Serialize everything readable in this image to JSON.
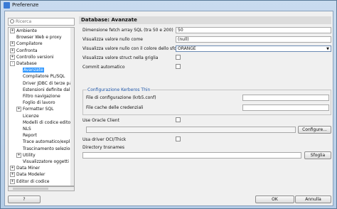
{
  "window": {
    "title": "Preferenze"
  },
  "search": {
    "placeholder": "Ricerca"
  },
  "tree": {
    "items": [
      {
        "label": "Ambiente",
        "level": 0,
        "expander": "+"
      },
      {
        "label": "Browser Web e proxy",
        "level": 0,
        "expander": ""
      },
      {
        "label": "Compilatore",
        "level": 0,
        "expander": "+"
      },
      {
        "label": "Confronta",
        "level": 0,
        "expander": "+"
      },
      {
        "label": "Controllo versioni",
        "level": 0,
        "expander": "+"
      },
      {
        "label": "Database",
        "level": 0,
        "expander": "-"
      },
      {
        "label": "Avanzate",
        "level": 1,
        "expander": "",
        "selected": true
      },
      {
        "label": "Compilatore PL/SQL",
        "level": 1,
        "expander": ""
      },
      {
        "label": "Driver JDBC di terze pa",
        "level": 1,
        "expander": ""
      },
      {
        "label": "Estensioni definite dall'i",
        "level": 1,
        "expander": ""
      },
      {
        "label": "Filtro navigazione",
        "level": 1,
        "expander": ""
      },
      {
        "label": "Foglio di lavoro",
        "level": 1,
        "expander": ""
      },
      {
        "label": "Formatter SQL",
        "level": 1,
        "expander": "+"
      },
      {
        "label": "Licenze",
        "level": 1,
        "expander": ""
      },
      {
        "label": "Modelli di codice editor",
        "level": 1,
        "expander": ""
      },
      {
        "label": "NLS",
        "level": 1,
        "expander": ""
      },
      {
        "label": "Report",
        "level": 1,
        "expander": ""
      },
      {
        "label": "Trace automatico/expla",
        "level": 1,
        "expander": ""
      },
      {
        "label": "Trascinamento selezion",
        "level": 1,
        "expander": ""
      },
      {
        "label": "Utility",
        "level": 1,
        "expander": "+"
      },
      {
        "label": "Visualizzatore oggetti",
        "level": 1,
        "expander": ""
      },
      {
        "label": "Data Miner",
        "level": 0,
        "expander": "+"
      },
      {
        "label": "Data Modeler",
        "level": 0,
        "expander": "+"
      },
      {
        "label": "Editor di codice",
        "level": 0,
        "expander": "+"
      }
    ]
  },
  "panel": {
    "title": "Database: Avanzate",
    "fetch_label": "Dimensione fetch array SQL (tra 50 e 200)",
    "fetch_value": "50",
    "null_label": "Visualizza valore nullo come",
    "null_value": "(null)",
    "null_color_label": "Visualizza valore nullo con il colore dello sfondo",
    "null_color_value": "ORANGE",
    "struct_label": "Visualizza valore struct nella griglia",
    "commit_label": "Commit automatico",
    "kerberos_title": "Configurazione Kerberos Thin",
    "config_file_label": "File di configurazione (krb5.conf)",
    "config_file_value": "",
    "cache_label": "File cache delle credenziali",
    "cache_value": "",
    "oracle_client_label": "Use Oracle Client",
    "oracle_client_value": "",
    "configure_button": "Configure...",
    "oci_label": "Usa driver OCI/Thick",
    "tns_label": "Directory tnsnames",
    "tns_value": "",
    "browse_button": "Sfoglia"
  },
  "footer": {
    "help_button": "?",
    "ok_button": "OK",
    "cancel_button": "Annulla"
  }
}
